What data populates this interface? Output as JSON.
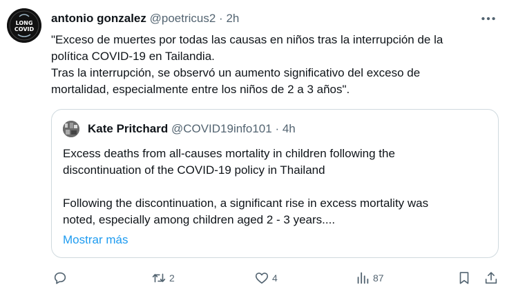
{
  "tweet": {
    "author": {
      "name": "antonio gonzalez",
      "handle": "@poetricus2",
      "time": "2h",
      "avatar_text_top": "LONG",
      "avatar_text_bottom": "COVID"
    },
    "text_lines": [
      "\"Exceso de muertes por todas las causas en niños tras la interrupción de la",
      "política COVID-19 en Tailandia.",
      "Tras la interrupción, se observó un aumento significativo del exceso de",
      "mortalidad, especialmente entre los niños de 2 a 3 años\"."
    ],
    "separator": "·"
  },
  "quote": {
    "author": {
      "name": "Kate Pritchard",
      "handle": "@COVID19info101",
      "time": "4h"
    },
    "paragraph1_lines": [
      "Excess deaths from all-causes mortality in children following the",
      "discontinuation of the COVID-19 policy in Thailand"
    ],
    "paragraph2_lines": [
      "Following the discontinuation, a significant rise in excess mortality was",
      "noted, especially among children aged 2 - 3 years...."
    ],
    "show_more": "Mostrar más"
  },
  "actions": {
    "reply_count": "",
    "retweet_count": "2",
    "like_count": "4",
    "views_count": "87"
  },
  "colors": {
    "text": "#0f1419",
    "secondary": "#536471",
    "link": "#1d9bf0",
    "border": "#cfd9de"
  },
  "icons": [
    "more-icon",
    "reply-icon",
    "retweet-icon",
    "like-icon",
    "views-icon",
    "bookmark-icon",
    "share-icon"
  ]
}
